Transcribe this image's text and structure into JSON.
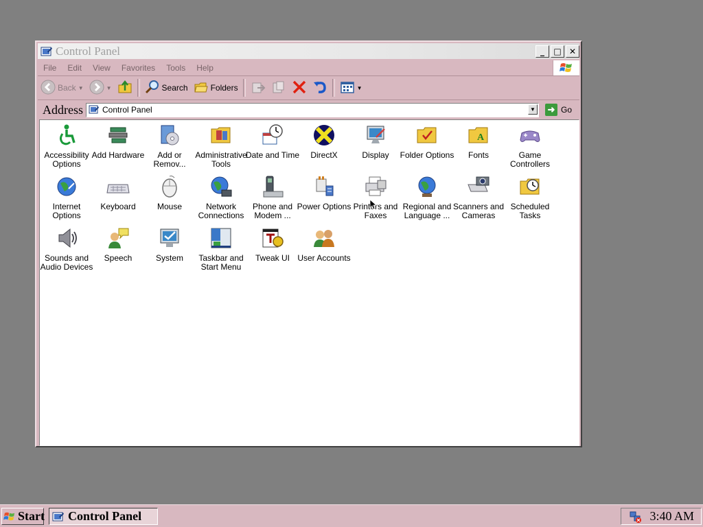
{
  "window": {
    "title": "Control Panel",
    "min_glyph": "_",
    "max_glyph": "□",
    "close_glyph": "✕"
  },
  "menu": [
    "File",
    "Edit",
    "View",
    "Favorites",
    "Tools",
    "Help"
  ],
  "toolbar": {
    "back_label": "Back",
    "search_label": "Search",
    "folders_label": "Folders"
  },
  "address": {
    "label": "Address",
    "value": "Control Panel",
    "go_label": "Go"
  },
  "icons": [
    {
      "label": "Accessibility Options",
      "icon": "accessibility-icon"
    },
    {
      "label": "Add Hardware",
      "icon": "add-hardware-icon"
    },
    {
      "label": "Add or Remov...",
      "icon": "add-remove-programs-icon"
    },
    {
      "label": "Administrative Tools",
      "icon": "administrative-tools-icon"
    },
    {
      "label": "Date and Time",
      "icon": "date-time-icon"
    },
    {
      "label": "DirectX",
      "icon": "directx-icon"
    },
    {
      "label": "Display",
      "icon": "display-icon"
    },
    {
      "label": "Folder Options",
      "icon": "folder-options-icon"
    },
    {
      "label": "Fonts",
      "icon": "fonts-icon"
    },
    {
      "label": "Game Controllers",
      "icon": "game-controllers-icon"
    },
    {
      "label": "Internet Options",
      "icon": "internet-options-icon"
    },
    {
      "label": "Keyboard",
      "icon": "keyboard-icon"
    },
    {
      "label": "Mouse",
      "icon": "mouse-icon"
    },
    {
      "label": "Network Connections",
      "icon": "network-connections-icon"
    },
    {
      "label": "Phone and Modem ...",
      "icon": "phone-modem-icon"
    },
    {
      "label": "Power Options",
      "icon": "power-options-icon"
    },
    {
      "label": "Printers and Faxes",
      "icon": "printers-faxes-icon"
    },
    {
      "label": "Regional and Language ...",
      "icon": "regional-language-icon"
    },
    {
      "label": "Scanners and Cameras",
      "icon": "scanners-cameras-icon"
    },
    {
      "label": "Scheduled Tasks",
      "icon": "scheduled-tasks-icon"
    },
    {
      "label": "Sounds and Audio Devices",
      "icon": "sounds-audio-icon"
    },
    {
      "label": "Speech",
      "icon": "speech-icon"
    },
    {
      "label": "System",
      "icon": "system-icon"
    },
    {
      "label": "Taskbar and Start Menu",
      "icon": "taskbar-start-menu-icon"
    },
    {
      "label": "Tweak UI",
      "icon": "tweak-ui-icon"
    },
    {
      "label": "User Accounts",
      "icon": "user-accounts-icon"
    }
  ],
  "taskbar": {
    "start_label": "Start",
    "task_label": "Control Panel",
    "clock": "3:40 AM"
  }
}
